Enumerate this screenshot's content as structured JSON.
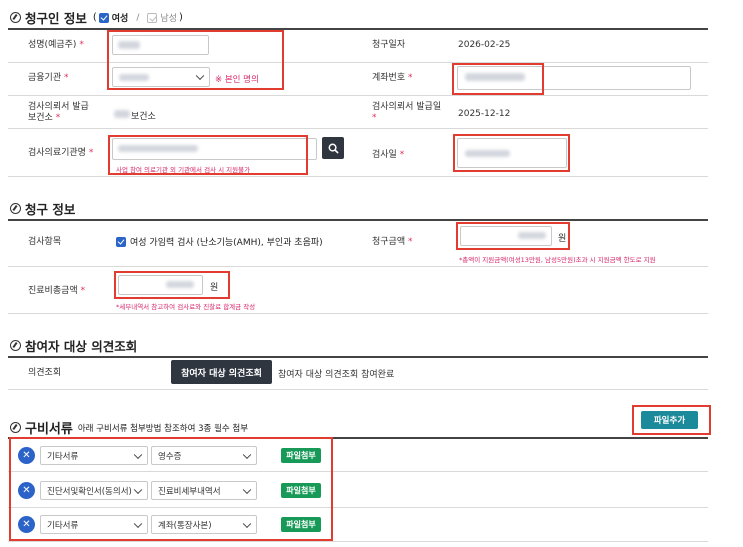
{
  "claimant": {
    "section_title": "청구인 정보",
    "gender_female": "여성",
    "gender_separator": "/",
    "gender_male": "남성",
    "name_label": "성명(예금주)",
    "claim_date_label": "청구일자",
    "claim_date_value": "2026-02-25",
    "bank_label": "금융기관",
    "bank_note": "※ 본인 명의",
    "account_label": "계좌번호",
    "exam_center_label_1": "검사의뢰서 발급",
    "exam_center_label_2": "보건소",
    "exam_center_value": "보건소",
    "exam_issue_date_label_1": "검사의뢰서 발급일",
    "exam_issue_date_value": "2025-12-12",
    "hospital_label": "검사의료기관명",
    "hospital_note": "사업 참여 의료기관 외 기관에서 검사 시 지원불가",
    "exam_date_label": "검사일",
    "required_mark": "*"
  },
  "claim": {
    "section_title": "청구 정보",
    "item_label": "검사항목",
    "item_value": "여성 가임력 검사 (난소기능(AMH), 부인과 초음파)",
    "amount_label": "청구금액",
    "amount_unit": "원",
    "amount_note": "*총액이 지원금액(여성13만원, 남성5만원)초과 시 지원금액 한도로 지원",
    "total_label": "진료비총금액",
    "total_unit": "원",
    "total_note": "*세부내역서 참고하여 검사료와 진찰료 합계금 작성"
  },
  "opinion": {
    "section_title": "참여자 대상 의견조회",
    "label": "의견조회",
    "button": "참여자 대상 의견조회",
    "status": "참여자 대상 의견조회 참여완료"
  },
  "docs": {
    "section_title": "구비서류",
    "subtitle": "아래 구비서류 첨부방법 참조하여 3종 필수 첨부",
    "add_button": "파일추가",
    "rows": [
      {
        "category": "기타서류",
        "type": "영수증",
        "attach": "파일첨부"
      },
      {
        "category": "진단서및확인서(동의서)",
        "type": "진료비세부내역서",
        "attach": "파일첨부"
      },
      {
        "category": "기타서류",
        "type": "계좌(통장사본)",
        "attach": "파일첨부"
      }
    ]
  },
  "icons": {
    "search": "search-icon",
    "remove": "close-icon",
    "chevron": "chevron-down-icon",
    "section": "pencil-icon"
  },
  "colors": {
    "required": "#e0305a",
    "highlight": "#e23b30",
    "attach": "#179a57",
    "add": "#1c8a9a",
    "remove": "#2c63c9"
  }
}
